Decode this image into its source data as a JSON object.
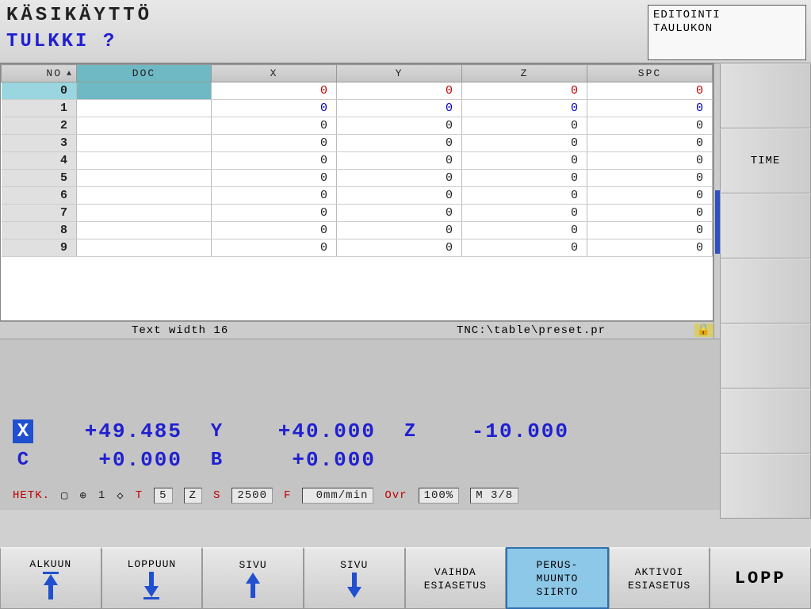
{
  "header": {
    "mode": "KÄSIKÄYTTÖ",
    "subtitle": "TULKKI ?",
    "editbox_l1": "EDITOINTI",
    "editbox_l2": "TAULUKON"
  },
  "side": {
    "time": "TIME"
  },
  "table": {
    "cols": {
      "no": "NO",
      "doc": "DOC",
      "x": "X",
      "y": "Y",
      "z": "Z",
      "spc": "SPC"
    },
    "rows": [
      {
        "no": "0",
        "doc": "",
        "x": "0",
        "y": "0",
        "z": "0",
        "spc": "0"
      },
      {
        "no": "1",
        "doc": "",
        "x": "0",
        "y": "0",
        "z": "0",
        "spc": "0"
      },
      {
        "no": "2",
        "doc": "",
        "x": "0",
        "y": "0",
        "z": "0",
        "spc": "0"
      },
      {
        "no": "3",
        "doc": "",
        "x": "0",
        "y": "0",
        "z": "0",
        "spc": "0"
      },
      {
        "no": "4",
        "doc": "",
        "x": "0",
        "y": "0",
        "z": "0",
        "spc": "0"
      },
      {
        "no": "5",
        "doc": "",
        "x": "0",
        "y": "0",
        "z": "0",
        "spc": "0"
      },
      {
        "no": "6",
        "doc": "",
        "x": "0",
        "y": "0",
        "z": "0",
        "spc": "0"
      },
      {
        "no": "7",
        "doc": "",
        "x": "0",
        "y": "0",
        "z": "0",
        "spc": "0"
      },
      {
        "no": "8",
        "doc": "",
        "x": "0",
        "y": "0",
        "z": "0",
        "spc": "0"
      },
      {
        "no": "9",
        "doc": "",
        "x": "0",
        "y": "0",
        "z": "0",
        "spc": "0"
      }
    ],
    "status_mid": "Text width 16",
    "status_file": "TNC:\\table\\preset.pr"
  },
  "pos": {
    "axes": [
      {
        "label": "X",
        "value": "+49.485",
        "active": true
      },
      {
        "label": "Y",
        "value": "+40.000",
        "active": false
      },
      {
        "label": "Z",
        "value": "-10.000",
        "active": false
      },
      {
        "label": "C",
        "value": "+0.000",
        "active": false
      },
      {
        "label": "B",
        "value": "+0.000",
        "active": false
      }
    ]
  },
  "info": {
    "hetk": "HETK.",
    "one": "1",
    "t": "T",
    "t_val": "5",
    "zchar": "Z",
    "s": "S",
    "s_val": "2500",
    "f": "F",
    "f_val": "0mm/min",
    "ovr": "Ovr",
    "ovr_val": "100%",
    "m": "M 3/8"
  },
  "softkeys": {
    "k1": "ALKUUN",
    "k2": "LOPPUUN",
    "k3": "SIVU",
    "k4": "SIVU",
    "k5a": "VAIHDA",
    "k5b": "ESIASETUS",
    "k6a": "PERUS-",
    "k6b": "MUUNTO",
    "k6c": "SIIRTO",
    "k7a": "AKTIVOI",
    "k7b": "ESIASETUS",
    "k8": "LOPP"
  }
}
